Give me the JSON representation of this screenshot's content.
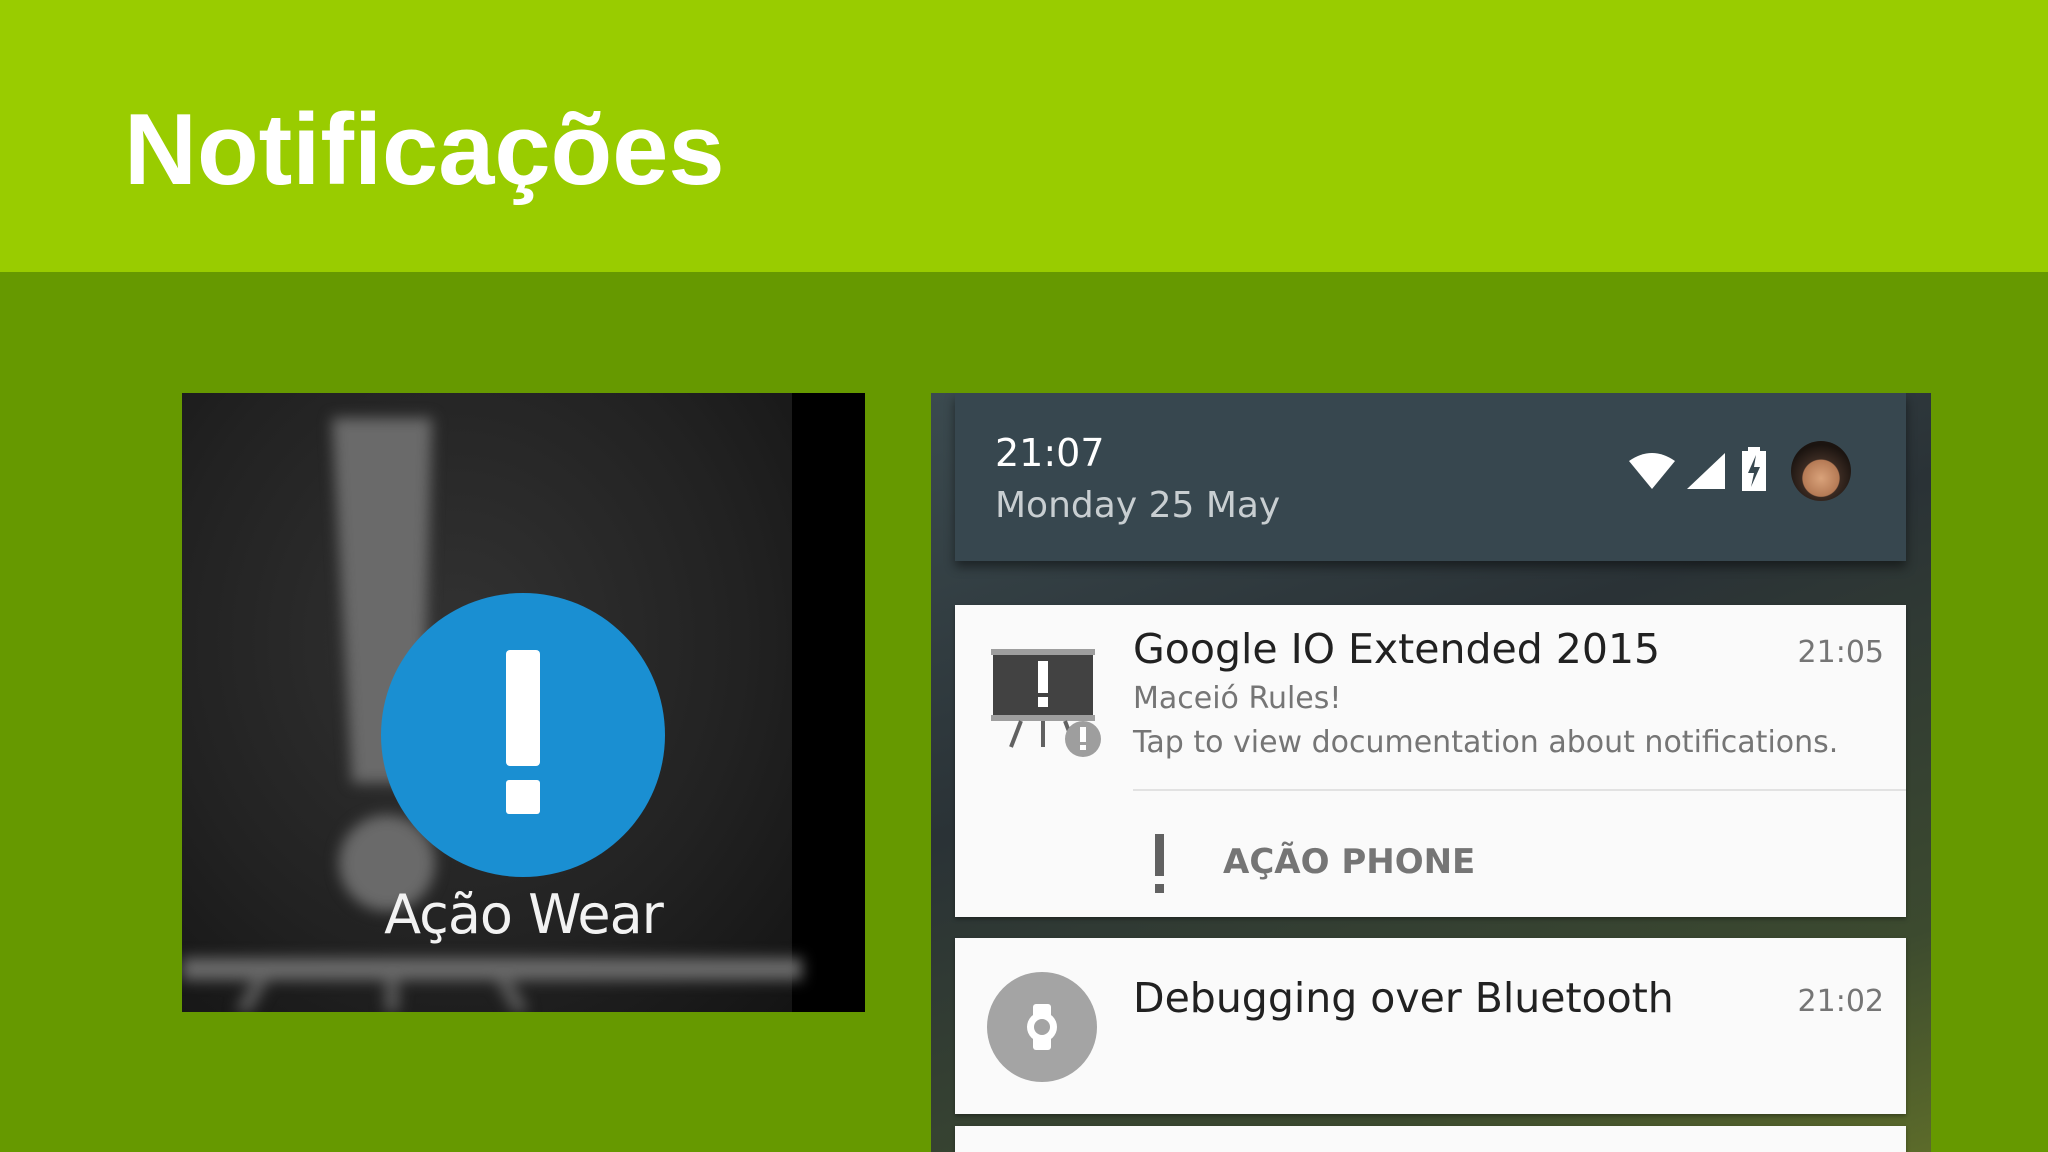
{
  "slide": {
    "title": "Notificações"
  },
  "wear": {
    "action_label": "Ação Wear",
    "circle_color": "#1a8fd2",
    "icon": "exclamation-icon"
  },
  "phone": {
    "status": {
      "time": "21:07",
      "date": "Monday 25 May",
      "icons": [
        "wifi-icon",
        "signal-icon",
        "battery-charging-icon",
        "avatar"
      ]
    },
    "notifications": [
      {
        "title": "Google IO Extended 2015",
        "time": "21:05",
        "subtitle": "Maceió Rules!",
        "text": "Tap to view documentation about notifications.",
        "icon": "presentation-alert-icon",
        "action": {
          "label": "AÇÃO PHONE",
          "icon": "exclamation-icon"
        }
      },
      {
        "title": "Debugging over Bluetooth",
        "time": "21:02",
        "icon": "watch-icon"
      }
    ]
  },
  "colors": {
    "header": "#99cc00",
    "background": "#669900",
    "quick_settings": "#37474f"
  }
}
